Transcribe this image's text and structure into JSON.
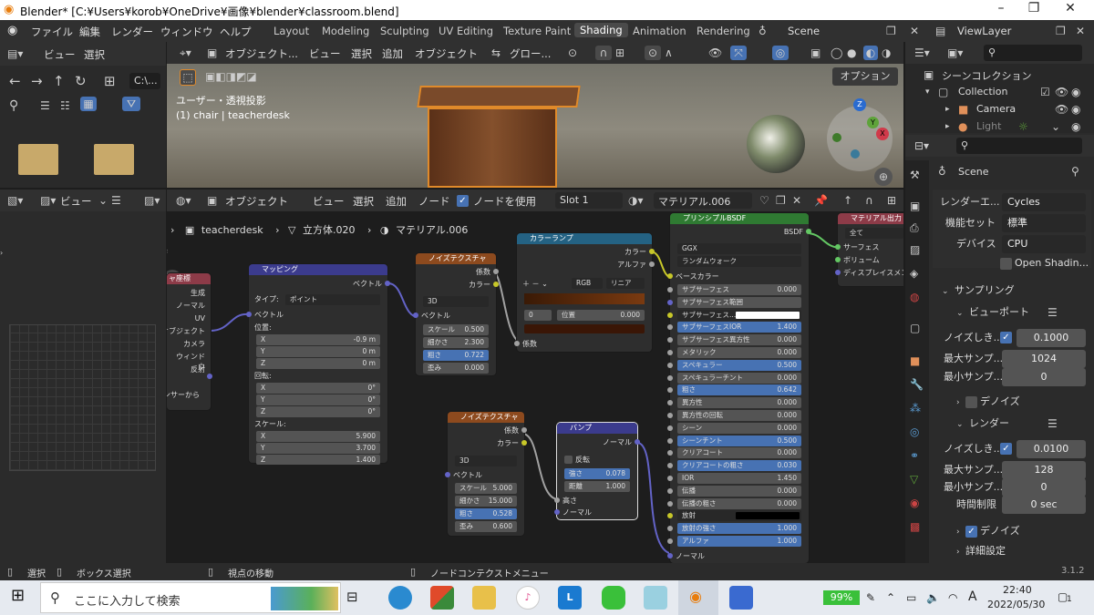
{
  "window": {
    "title": "Blender* [C:¥Users¥korob¥OneDrive¥画像¥blender¥classroom.blend]"
  },
  "menu": [
    "ファイル",
    "編集",
    "レンダー",
    "ウィンドウ",
    "ヘルプ"
  ],
  "workspaces": [
    "Layout",
    "Modeling",
    "Sculpting",
    "UV Editing",
    "Texture Paint",
    "Shading",
    "Animation",
    "Rendering"
  ],
  "active_workspace": "Shading",
  "scene_name": "Scene",
  "view_layer": "ViewLayer",
  "file_browser": {
    "menu": [
      "ビュー",
      "選択"
    ],
    "path": "C:\\..."
  },
  "viewport": {
    "mode": "オブジェクト...",
    "menu": [
      "ビュー",
      "選択",
      "追加",
      "オブジェクト"
    ],
    "transform": "グロー...",
    "options": "オプション",
    "overlay_line1": "ユーザー・透視投影",
    "overlay_line2": "(1) chair | teacherdesk",
    "gizmo": {
      "z": "Z",
      "y": "Y",
      "x": "X"
    }
  },
  "node_editor": {
    "view_label": "ビュー",
    "object_label": "オブジェクト",
    "menu": [
      "ビュー",
      "選択",
      "追加",
      "ノード"
    ],
    "use_nodes": "ノードを使用",
    "slot": "Slot 1",
    "material": "マテリアル.006",
    "breadcrumb": [
      "teacherdesk",
      "立方体.020",
      "マテリアル.006"
    ]
  },
  "nodes": {
    "texcoord": {
      "title": "ャ座標",
      "outputs": [
        "生成",
        "ノーマル",
        "UV",
        "オブジェクト",
        "カメラ",
        "ウィンドウ",
        "反射"
      ],
      "footer": "ンサーから"
    },
    "mapping": {
      "title": "マッピング",
      "output": "ベクトル",
      "type_label": "タイプ:",
      "type_value": "ポイント",
      "vector": "ベクトル",
      "location_label": "位置:",
      "location": [
        [
          "X",
          "-0.9 m"
        ],
        [
          "Y",
          "0 m"
        ],
        [
          "Z",
          "0 m"
        ]
      ],
      "rotation_label": "回転:",
      "rotation": [
        [
          "X",
          "0°"
        ],
        [
          "Y",
          "0°"
        ],
        [
          "Z",
          "0°"
        ]
      ],
      "scale_label": "スケール:",
      "scale": [
        [
          "X",
          "5.900"
        ],
        [
          "Y",
          "3.700"
        ],
        [
          "Z",
          "1.400"
        ]
      ]
    },
    "noise1": {
      "title": "ノイズテクスチャ",
      "outputs": [
        "係数",
        "カラー"
      ],
      "dim": "3D",
      "vector": "ベクトル",
      "fields": [
        [
          "スケール",
          "0.500"
        ],
        [
          "細かさ",
          "2.300"
        ],
        [
          "粗さ",
          "0.722"
        ],
        [
          "歪み",
          "0.000"
        ]
      ]
    },
    "colorramp": {
      "title": "カラーランプ",
      "outputs": [
        "カラー",
        "アルファ"
      ],
      "mode": "RGB",
      "interp": "リニア",
      "index": "0",
      "pos_label": "位置",
      "pos_value": "0.000",
      "input": "係数"
    },
    "noise2": {
      "title": "ノイズテクスチャ",
      "outputs": [
        "係数",
        "カラー"
      ],
      "dim": "3D",
      "vector": "ベクトル",
      "fields": [
        [
          "スケール",
          "5.000"
        ],
        [
          "細かさ",
          "15.000"
        ],
        [
          "粗さ",
          "0.528"
        ],
        [
          "歪み",
          "0.600"
        ]
      ]
    },
    "bump": {
      "title": "バンプ",
      "output": "ノーマル",
      "invert": "反転",
      "fields": [
        [
          "強さ",
          "0.078"
        ],
        [
          "距離",
          "1.000"
        ]
      ],
      "inputs": [
        "高さ",
        "ノーマル"
      ]
    },
    "bsdf": {
      "title": "プリンシプルBSDF",
      "output": "BSDF",
      "dist": "GGX",
      "sss": "ランダムウォーク",
      "base_color": "ベースカラー",
      "fields": [
        [
          "サブサーフェス",
          "0.000"
        ],
        [
          "サブサーフェス範囲",
          ""
        ],
        [
          "サブサーフェス...",
          ""
        ],
        [
          "サブサーフェスIOR",
          "1.400"
        ],
        [
          "サブサーフェス異方性",
          "0.000"
        ],
        [
          "メタリック",
          "0.000"
        ],
        [
          "スペキュラー",
          "0.500"
        ],
        [
          "スペキュラーチント",
          "0.000"
        ],
        [
          "粗さ",
          "0.642"
        ],
        [
          "異方性",
          "0.000"
        ],
        [
          "異方性の回転",
          "0.000"
        ],
        [
          "シーン",
          "0.000"
        ],
        [
          "シーンチント",
          "0.500"
        ],
        [
          "クリアコート",
          "0.000"
        ],
        [
          "クリアコートの粗さ",
          "0.030"
        ],
        [
          "IOR",
          "1.450"
        ],
        [
          "伝播",
          "0.000"
        ],
        [
          "伝播の粗さ",
          "0.000"
        ],
        [
          "放射",
          ""
        ],
        [
          "放射の強さ",
          "1.000"
        ],
        [
          "アルファ",
          "1.000"
        ]
      ],
      "normal": "ノーマル"
    },
    "output": {
      "title": "マテリアル出力",
      "target": "全て",
      "inputs": [
        "サーフェス",
        "ボリューム",
        "ディスプレイスメント"
      ]
    }
  },
  "outliner": {
    "scene_collection": "シーンコレクション",
    "items": [
      "Collection",
      "Camera",
      "Light"
    ]
  },
  "properties": {
    "scene": "Scene",
    "render_engine_label": "レンダーエ...",
    "render_engine": "Cycles",
    "feature_set_label": "機能セット",
    "feature_set": "標準",
    "device_label": "デバイス",
    "device": "CPU",
    "open_shading": "Open Shadin...",
    "sampling": "サンプリング",
    "viewport": "ビューポート",
    "noise_threshold_label": "ノイズしき...",
    "vp_noise": "0.1000",
    "max_samples_label": "最大サンプ...",
    "vp_max": "1024",
    "min_samples_label": "最小サンプ...",
    "vp_min": "0",
    "denoise": "デノイズ",
    "render": "レンダー",
    "r_noise": "0.0100",
    "r_max": "128",
    "r_min": "0",
    "time_limit_label": "時間制限",
    "time_limit": "0 sec",
    "advanced": "詳細設定"
  },
  "statusbar": {
    "select": "選択",
    "box_select": "ボックス選択",
    "move_view": "視点の移動",
    "context_menu": "ノードコンテクストメニュー",
    "version": "3.1.2"
  },
  "taskbar": {
    "search_placeholder": "ここに入力して検索",
    "battery": "99%",
    "time": "22:40",
    "date": "2022/05/30",
    "ime": "A",
    "notif": "1"
  }
}
